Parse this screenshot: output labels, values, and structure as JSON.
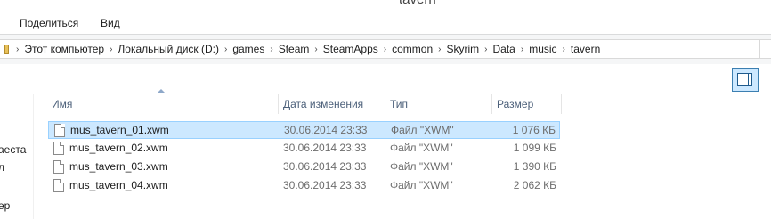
{
  "window": {
    "title": "tavern"
  },
  "ribbon": {
    "tabs": [
      "Поделиться",
      "Вид"
    ]
  },
  "address": {
    "crumbs": [
      "Этот компьютер",
      "Локальный диск (D:)",
      "games",
      "Steam",
      "SteamApps",
      "common",
      "Skyrim",
      "Data",
      "music",
      "tavern"
    ]
  },
  "nav": {
    "items": [
      "аеста",
      "л",
      "ер"
    ]
  },
  "columns": {
    "name": "Имя",
    "date": "Дата изменения",
    "type": "Тип",
    "size": "Размер"
  },
  "files": [
    {
      "name": "mus_tavern_01.xwm",
      "date": "30.06.2014 23:33",
      "type": "Файл \"XWM\"",
      "size": "1 076 КБ",
      "selected": true
    },
    {
      "name": "mus_tavern_02.xwm",
      "date": "30.06.2014 23:33",
      "type": "Файл \"XWM\"",
      "size": "1 099 КБ",
      "selected": false
    },
    {
      "name": "mus_tavern_03.xwm",
      "date": "30.06.2014 23:33",
      "type": "Файл \"XWM\"",
      "size": "1 390 КБ",
      "selected": false
    },
    {
      "name": "mus_tavern_04.xwm",
      "date": "30.06.2014 23:33",
      "type": "Файл \"XWM\"",
      "size": "2 062 КБ",
      "selected": false
    }
  ],
  "icons": {
    "file": "file-icon",
    "view_pane": "preview-pane-icon",
    "sort": "sort-ascending-icon"
  },
  "colors": {
    "selection": "#cce8ff",
    "selection_border": "#99d1ff",
    "header_text": "#4c607a"
  }
}
